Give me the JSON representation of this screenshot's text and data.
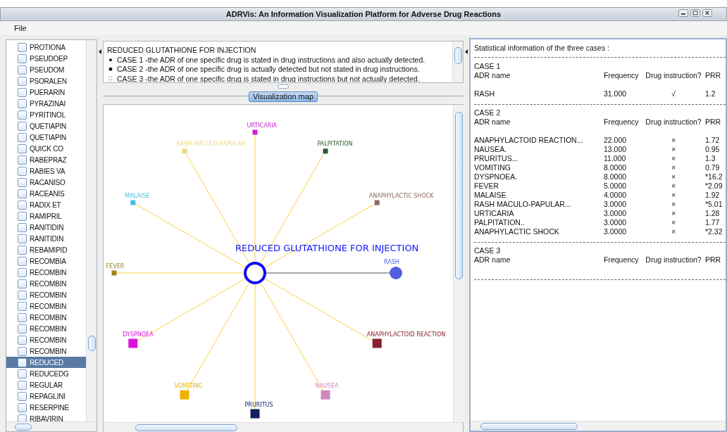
{
  "window": {
    "title": "ADRVis: An Information Visualization Platform for Adverse Drug Reactions"
  },
  "menu": [
    "File"
  ],
  "drug_list": [
    {
      "label": "PROTIONA",
      "checked": false,
      "selected": false
    },
    {
      "label": "PSEUDOEP",
      "checked": false,
      "selected": false
    },
    {
      "label": "PSEUDOM",
      "checked": false,
      "selected": false
    },
    {
      "label": "PSORALEN",
      "checked": false,
      "selected": false
    },
    {
      "label": "PUERARIN",
      "checked": false,
      "selected": false
    },
    {
      "label": "PYRAZINAI",
      "checked": false,
      "selected": false
    },
    {
      "label": "PYRITINOL",
      "checked": false,
      "selected": false
    },
    {
      "label": "QUETIAPIN",
      "checked": false,
      "selected": false
    },
    {
      "label": "QUETIAPIN",
      "checked": false,
      "selected": false
    },
    {
      "label": "QUICK CO",
      "checked": false,
      "selected": false
    },
    {
      "label": "RABEPRAZ",
      "checked": false,
      "selected": false
    },
    {
      "label": "RABIES VA",
      "checked": false,
      "selected": false
    },
    {
      "label": "RACANISO",
      "checked": false,
      "selected": false
    },
    {
      "label": "RACEANIS",
      "checked": false,
      "selected": false
    },
    {
      "label": "RADIX ET",
      "checked": false,
      "selected": false
    },
    {
      "label": "RAMIPRIL",
      "checked": false,
      "selected": false
    },
    {
      "label": "RANITIDIN",
      "checked": false,
      "selected": false
    },
    {
      "label": "RANITIDIN",
      "checked": false,
      "selected": false
    },
    {
      "label": "REBAMIPID",
      "checked": false,
      "selected": false
    },
    {
      "label": "RECOMBIA",
      "checked": false,
      "selected": false
    },
    {
      "label": "RECOMBIN",
      "checked": false,
      "selected": false
    },
    {
      "label": "RECOMBIN",
      "checked": false,
      "selected": false
    },
    {
      "label": "RECOMBIN",
      "checked": false,
      "selected": false
    },
    {
      "label": "RECOMBIN",
      "checked": false,
      "selected": false
    },
    {
      "label": "RECOMBIN",
      "checked": false,
      "selected": false
    },
    {
      "label": "RECOMBIN",
      "checked": false,
      "selected": false
    },
    {
      "label": "RECOMBIN",
      "checked": false,
      "selected": false
    },
    {
      "label": "RECOMBIN",
      "checked": false,
      "selected": false
    },
    {
      "label": "REDUCED",
      "checked": false,
      "selected": true
    },
    {
      "label": "REDUCEDG",
      "checked": false,
      "selected": false
    },
    {
      "label": "REGULAR",
      "checked": false,
      "selected": false
    },
    {
      "label": "REPAGLINI",
      "checked": false,
      "selected": false
    },
    {
      "label": "RESERPINE",
      "checked": false,
      "selected": false
    },
    {
      "label": "RIBAVIRIN",
      "checked": false,
      "selected": false
    }
  ],
  "legend": {
    "title": "REDUCED GLUTATHIONE FOR INJECTION",
    "lines": [
      {
        "marker": "●",
        "text": "CASE 1 -the ADR of one specific drug is stated in drug instructions and also actually detected."
      },
      {
        "marker": "■",
        "text": "CASE 2 -the ADR of one specific drug is actually detected but not stated in drug instructions."
      },
      {
        "marker": "∷",
        "text": "CASE 3 -the ADR of one specific drug is stated in drug instructions but not actually detected."
      }
    ]
  },
  "map_button": "Visualization map",
  "graph": {
    "title": "REDUCED GLUTATHIONE FOR INJECTION",
    "nodes": [
      {
        "label": "RASH",
        "kind": "circle",
        "color": "#5060e0"
      },
      {
        "label": "ANAPHYLACTIC SHOCK",
        "kind": "small-square",
        "color": "#8a6a60"
      },
      {
        "label": "PALPITATION",
        "kind": "small-square",
        "color": "#2a5a2a"
      },
      {
        "label": "URTICARIA",
        "kind": "small-square",
        "color": "#cc22cc"
      },
      {
        "label": "RASH MACULO-PAPULAR",
        "kind": "small-square",
        "color": "#e8d880"
      },
      {
        "label": "MALAISE",
        "kind": "small-square",
        "color": "#40c0e0"
      },
      {
        "label": "FEVER",
        "kind": "small-square",
        "color": "#a08020"
      },
      {
        "label": "DYSPNOEA",
        "kind": "large-square",
        "color": "#dd11dd"
      },
      {
        "label": "VOMITING",
        "kind": "large-square",
        "color": "#f0b000"
      },
      {
        "label": "PRURITUS",
        "kind": "large-square",
        "color": "#102060"
      },
      {
        "label": "NAUSEA",
        "kind": "large-square",
        "color": "#cc88bb"
      },
      {
        "label": "ANAPHYLACTOID REACTION",
        "kind": "large-square",
        "color": "#882030"
      }
    ]
  },
  "stats": {
    "title": "Statistical information of the three cases :",
    "cases": [
      {
        "name": "CASE 1",
        "columns": [
          "ADR name",
          "Frequency",
          "Drug instruction?",
          "PRR"
        ],
        "rows": [
          [
            "RASH",
            "31.000",
            "√",
            "1.2"
          ]
        ]
      },
      {
        "name": "CASE 2",
        "columns": [
          "ADR name",
          "Frequency",
          "Drug instruction?",
          "PRR"
        ],
        "rows": [
          [
            "ANAPHYLACTOID REACTION...",
            "22.000",
            "×",
            "1.72"
          ],
          [
            "NAUSEA.",
            "13.000",
            "×",
            "0.95"
          ],
          [
            "PRURITUS...",
            "11.000",
            "×",
            "1.3"
          ],
          [
            "VOMITING",
            "8.0000",
            "×",
            "0.79"
          ],
          [
            "DYSPNOEA.",
            "8.0000",
            "×",
            "*16.2"
          ],
          [
            "FEVER",
            "5.0000",
            "×",
            "*2.09"
          ],
          [
            "MALAISE",
            "4.0000",
            "×",
            "1.92"
          ],
          [
            "RASH MACULO-PAPULAR...",
            "3.0000",
            "×",
            "*5.01"
          ],
          [
            "URTICARIA",
            "3.0000",
            "×",
            "1.28"
          ],
          [
            "PALPITATION..",
            "3.0000",
            "×",
            "1.77"
          ],
          [
            "ANAPHYLACTIC SHOCK",
            "3.0000",
            "×",
            "*2.32"
          ]
        ]
      },
      {
        "name": "CASE 3",
        "columns": [
          "ADR name",
          "Frequency",
          "Drug instruction?",
          "PRR"
        ]
      }
    ]
  }
}
